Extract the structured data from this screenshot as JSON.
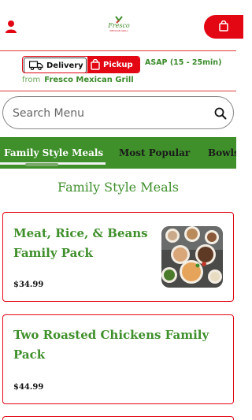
{
  "header": {
    "logo_text": "Fresco",
    "logo_subtext": "MEXICAN GRILL",
    "user_icon": "user-icon",
    "cart_icon": "shopping-bag-icon",
    "accent_color": "#e30613",
    "brand_green": "#3f8f2b"
  },
  "order_bar": {
    "delivery_label": "Delivery",
    "pickup_label": "Pickup",
    "selected": "Pickup",
    "eta": "ASAP (15 - 25min)",
    "from_label": "from",
    "restaurant": "Fresco Mexican Grill"
  },
  "search": {
    "placeholder": "Search Menu",
    "value": ""
  },
  "tabs": [
    {
      "label": "Family Style Meals",
      "active": true
    },
    {
      "label": "Most Popular",
      "active": false
    },
    {
      "label": "Bowls",
      "active": false
    }
  ],
  "section": {
    "title": "Family Style Meals"
  },
  "items": [
    {
      "name": "Meat, Rice, & Beans Family Pack",
      "price": "$34.99",
      "has_image": true
    },
    {
      "name": "Two Roasted Chickens Family Pack",
      "price": "$44.99",
      "has_image": false
    }
  ]
}
